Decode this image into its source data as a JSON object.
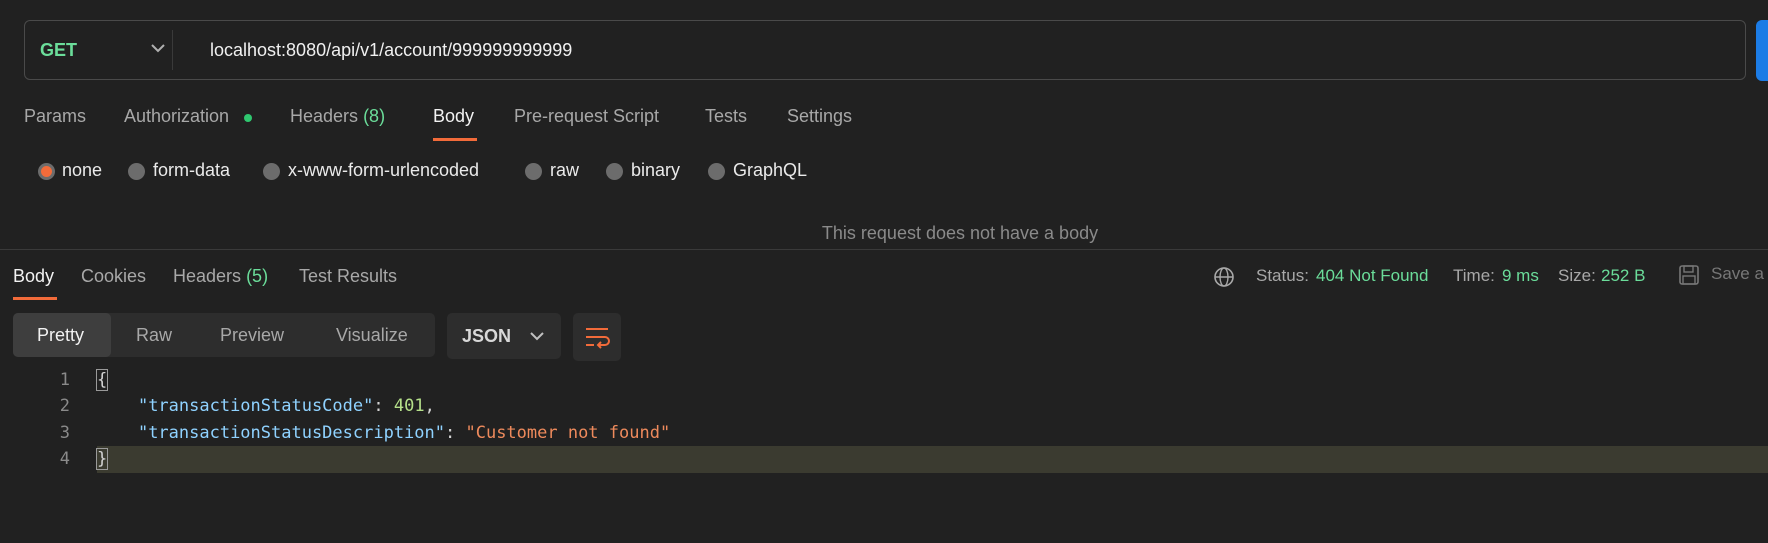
{
  "request": {
    "method": "GET",
    "url": "localhost:8080/api/v1/account/999999999999",
    "tabs": [
      {
        "label": "Params"
      },
      {
        "label": "Authorization"
      },
      {
        "label": "Headers",
        "count": "(8)"
      },
      {
        "label": "Body"
      },
      {
        "label": "Pre-request Script"
      },
      {
        "label": "Tests"
      },
      {
        "label": "Settings"
      }
    ],
    "active_tab": "Body",
    "body_types": [
      "none",
      "form-data",
      "x-www-form-urlencoded",
      "raw",
      "binary",
      "GraphQL"
    ],
    "selected_body_type": "none",
    "no_body_message": "This request does not have a body"
  },
  "response": {
    "tabs": [
      {
        "label": "Body"
      },
      {
        "label": "Cookies"
      },
      {
        "label": "Headers",
        "count": "(5)"
      },
      {
        "label": "Test Results"
      }
    ],
    "active_tab": "Body",
    "status_label": "Status:",
    "status_value": "404 Not Found",
    "time_label": "Time:",
    "time_value": "9 ms",
    "size_label": "Size:",
    "size_value": "252 B",
    "save_label": "Save a",
    "view_modes": [
      "Pretty",
      "Raw",
      "Preview",
      "Visualize"
    ],
    "active_view_mode": "Pretty",
    "format": "JSON",
    "line_numbers": [
      "1",
      "2",
      "3",
      "4"
    ],
    "code": {
      "open_brace": "{",
      "key1": "\"transactionStatusCode\"",
      "val1": "401",
      "key2": "\"transactionStatusDescription\"",
      "val2": "\"Customer not found\"",
      "close_brace": "}"
    }
  },
  "colors": {
    "accent": "#f26b3a",
    "success_green": "#6bdd9a",
    "send_blue": "#1c7ce6",
    "background": "#212121"
  },
  "icons": {
    "method_dropdown": "chevron-down-icon",
    "globe": "globe-icon",
    "save": "save-icon",
    "format_dropdown": "chevron-down-icon",
    "wrap": "wrap-lines-icon"
  }
}
